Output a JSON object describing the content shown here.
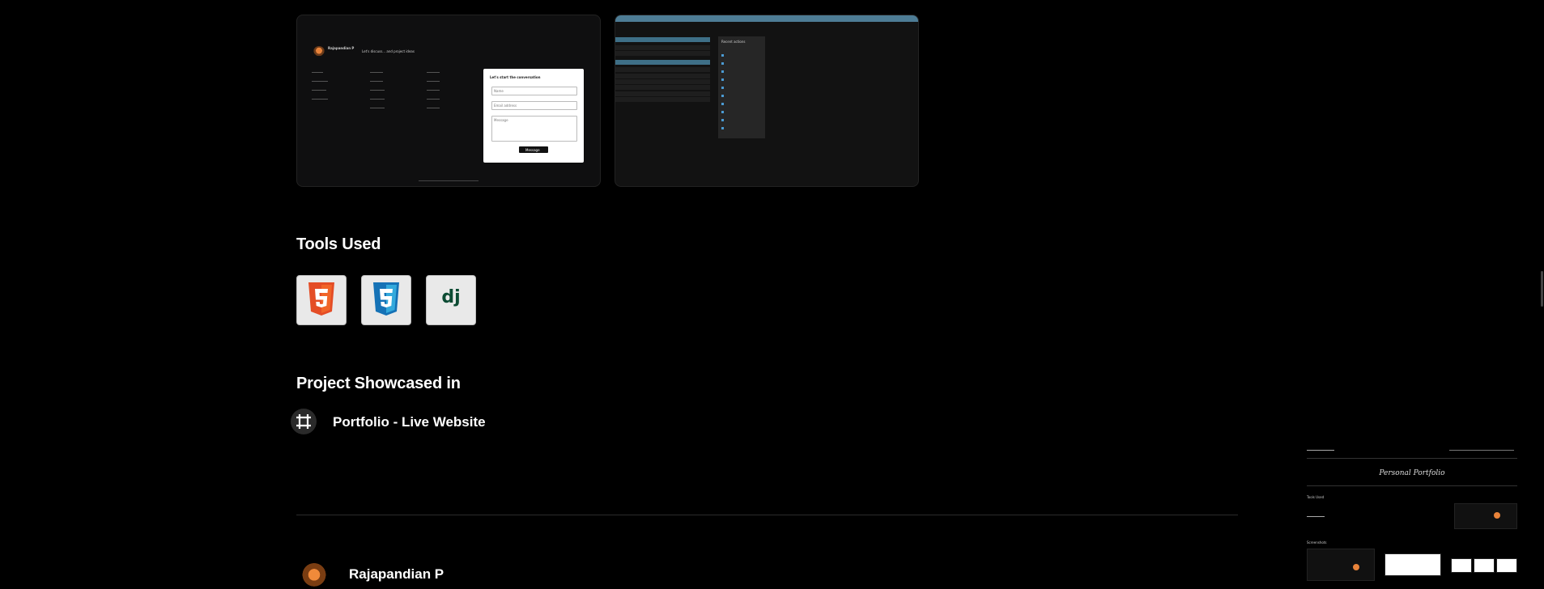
{
  "screenshots": {
    "first": {
      "author": "Rajapandian P",
      "tagline": "Let's discuss... and project ideas",
      "contact_heading": "Let's start the conversation",
      "name_placeholder": "Name",
      "email_placeholder": "Email address",
      "message_placeholder": "Message",
      "submit_label": "Message"
    },
    "second": {
      "sidebar_heading": "Recent actions"
    }
  },
  "tools_heading": "Tools Used",
  "tools": [
    {
      "name": "HTML5",
      "icon": "html5-icon",
      "color": "#e44d26"
    },
    {
      "name": "CSS3",
      "icon": "css3-icon",
      "color": "#1572b6"
    },
    {
      "name": "Django",
      "icon": "django-icon",
      "glyph": "dj",
      "color": "#0c4b33"
    }
  ],
  "showcase_heading": "Project Showcased in",
  "showcase": {
    "link_text": "Portfolio - Live Website",
    "icon": "frame-icon"
  },
  "author": {
    "name": "Rajapandian P"
  },
  "minimap": {
    "title": "Personal Portfolio",
    "section_tools": "Tools Used",
    "section_screens": "Screenshots"
  }
}
